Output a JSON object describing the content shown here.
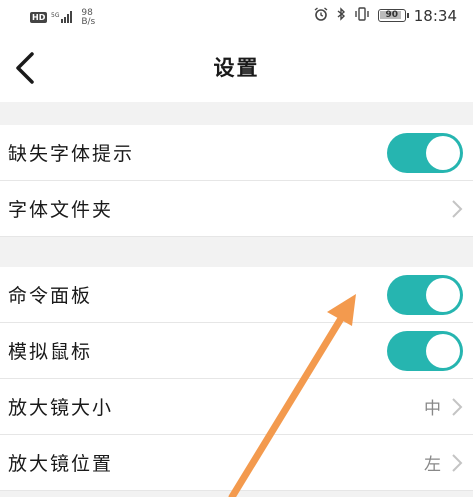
{
  "status_bar": {
    "hd": "HD",
    "net_top": "98",
    "net_bottom": "B/s",
    "battery": "90",
    "battery_level": 0.9,
    "time": "18:34"
  },
  "header": {
    "title": "设置",
    "back_icon": "chevron-left-icon"
  },
  "section1": {
    "missing_font_label": "缺失字体提示",
    "missing_font_enabled": true,
    "font_folder_label": "字体文件夹"
  },
  "section2": {
    "command_panel_label": "命令面板",
    "command_panel_enabled": true,
    "simulate_mouse_label": "模拟鼠标",
    "simulate_mouse_enabled": true,
    "magnifier_size_label": "放大镜大小",
    "magnifier_size_value": "中",
    "magnifier_position_label": "放大镜位置",
    "magnifier_position_value": "左"
  },
  "colors": {
    "toggle_on": "#26b5b0",
    "section_gap": "#f2f2f2",
    "annotation_arrow": "#f39a4e"
  }
}
